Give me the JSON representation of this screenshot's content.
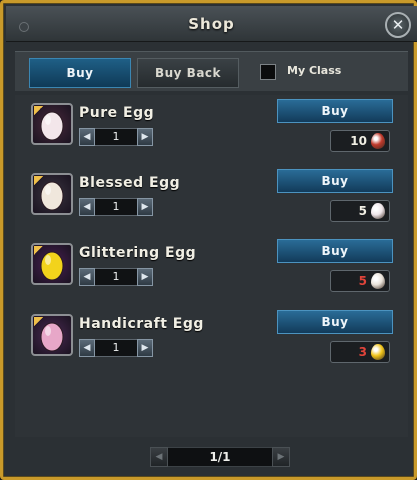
{
  "window": {
    "title": "Shop"
  },
  "tabs": {
    "buy": "Buy",
    "buy_back": "Buy Back"
  },
  "filter": {
    "my_class_label": "My Class",
    "my_class_checked": false
  },
  "items": [
    {
      "name": "Pure Egg",
      "quantity": "1",
      "buy_label": "Buy",
      "price": "10",
      "price_color": "#f1efe4",
      "icon": "pure-egg-icon",
      "icon_color": "#f3e6ea",
      "icon_bg": "#4b2a3d",
      "currency_icon": "red-gem-icon",
      "currency_color": "#c0392b"
    },
    {
      "name": "Blessed Egg",
      "quantity": "1",
      "buy_label": "Buy",
      "price": "5",
      "price_color": "#f1efe4",
      "icon": "blessed-egg-icon",
      "icon_color": "#f0e7dc",
      "icon_bg": "#3a3540",
      "currency_icon": "white-egg-icon",
      "currency_color": "#efe6ea"
    },
    {
      "name": "Glittering Egg",
      "quantity": "1",
      "buy_label": "Buy",
      "price": "5",
      "price_color": "#e0443a",
      "icon": "glittering-egg-icon",
      "icon_color": "#f2d31b",
      "icon_bg": "#4a1f55",
      "currency_icon": "blessed-egg-icon",
      "currency_color": "#eae3da"
    },
    {
      "name": "Handicraft Egg",
      "quantity": "1",
      "buy_label": "Buy",
      "price": "3",
      "price_color": "#e0443a",
      "icon": "handicraft-egg-icon",
      "icon_color": "#e7a7c8",
      "icon_bg": "#4b2a54",
      "currency_icon": "gold-egg-icon",
      "currency_color": "#f0c419"
    }
  ],
  "pager": {
    "value": "1/1"
  }
}
